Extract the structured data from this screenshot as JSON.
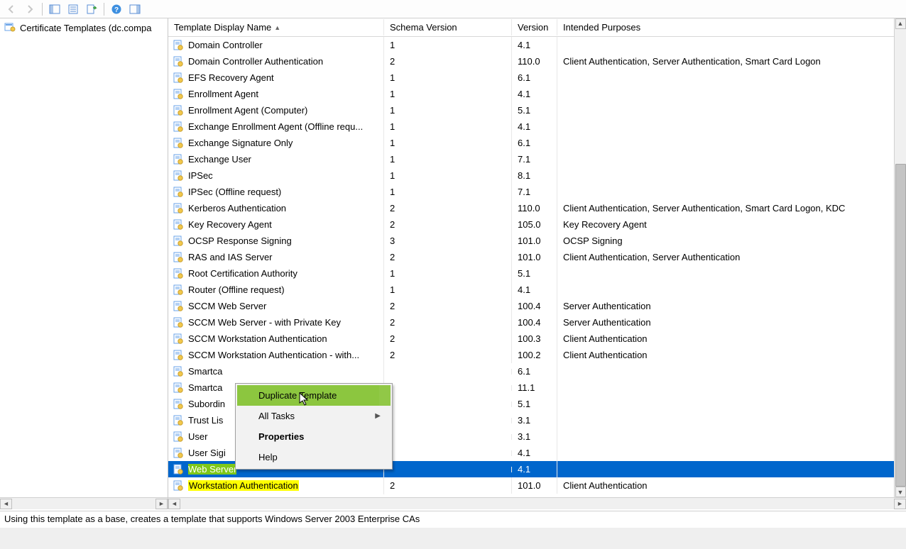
{
  "tree": {
    "root_label": "Certificate Templates (dc.compa"
  },
  "columns": {
    "name": "Template Display Name",
    "schema": "Schema Version",
    "version": "Version",
    "purposes": "Intended Purposes"
  },
  "rows": [
    {
      "name": "Domain Controller",
      "schema": "1",
      "version": "4.1",
      "purposes": ""
    },
    {
      "name": "Domain Controller Authentication",
      "schema": "2",
      "version": "110.0",
      "purposes": "Client Authentication, Server Authentication, Smart Card Logon"
    },
    {
      "name": "EFS Recovery Agent",
      "schema": "1",
      "version": "6.1",
      "purposes": ""
    },
    {
      "name": "Enrollment Agent",
      "schema": "1",
      "version": "4.1",
      "purposes": ""
    },
    {
      "name": "Enrollment Agent (Computer)",
      "schema": "1",
      "version": "5.1",
      "purposes": ""
    },
    {
      "name": "Exchange Enrollment Agent (Offline requ...",
      "schema": "1",
      "version": "4.1",
      "purposes": ""
    },
    {
      "name": "Exchange Signature Only",
      "schema": "1",
      "version": "6.1",
      "purposes": ""
    },
    {
      "name": "Exchange User",
      "schema": "1",
      "version": "7.1",
      "purposes": ""
    },
    {
      "name": "IPSec",
      "schema": "1",
      "version": "8.1",
      "purposes": ""
    },
    {
      "name": "IPSec (Offline request)",
      "schema": "1",
      "version": "7.1",
      "purposes": ""
    },
    {
      "name": "Kerberos Authentication",
      "schema": "2",
      "version": "110.0",
      "purposes": "Client Authentication, Server Authentication, Smart Card Logon, KDC"
    },
    {
      "name": "Key Recovery Agent",
      "schema": "2",
      "version": "105.0",
      "purposes": "Key Recovery Agent"
    },
    {
      "name": "OCSP Response Signing",
      "schema": "3",
      "version": "101.0",
      "purposes": "OCSP Signing"
    },
    {
      "name": "RAS and IAS Server",
      "schema": "2",
      "version": "101.0",
      "purposes": "Client Authentication, Server Authentication"
    },
    {
      "name": "Root Certification Authority",
      "schema": "1",
      "version": "5.1",
      "purposes": ""
    },
    {
      "name": "Router (Offline request)",
      "schema": "1",
      "version": "4.1",
      "purposes": ""
    },
    {
      "name": "SCCM Web Server",
      "schema": "2",
      "version": "100.4",
      "purposes": "Server Authentication"
    },
    {
      "name": "SCCM Web Server - with Private Key",
      "schema": "2",
      "version": "100.4",
      "purposes": "Server Authentication"
    },
    {
      "name": "SCCM Workstation Authentication",
      "schema": "2",
      "version": "100.3",
      "purposes": "Client Authentication"
    },
    {
      "name": "SCCM Workstation Authentication - with...",
      "schema": "2",
      "version": "100.2",
      "purposes": "Client Authentication"
    },
    {
      "name": "Smartca",
      "schema": "",
      "version": "6.1",
      "purposes": ""
    },
    {
      "name": "Smartca",
      "schema": "",
      "version": "11.1",
      "purposes": ""
    },
    {
      "name": "Subordin",
      "schema": "",
      "version": "5.1",
      "purposes": ""
    },
    {
      "name": "Trust Lis",
      "schema": "",
      "version": "3.1",
      "purposes": ""
    },
    {
      "name": "User",
      "schema": "",
      "version": "3.1",
      "purposes": ""
    },
    {
      "name": "User Sigi",
      "schema": "",
      "version": "4.1",
      "purposes": ""
    },
    {
      "name": "Web Server",
      "schema": "",
      "version": "4.1",
      "purposes": "",
      "selected": true,
      "hl_green": true
    },
    {
      "name": "Workstation Authentication",
      "schema": "2",
      "version": "101.0",
      "purposes": "Client Authentication",
      "hl_yellow": true
    }
  ],
  "context_menu": {
    "duplicate": "Duplicate Template",
    "all_tasks": "All Tasks",
    "properties": "Properties",
    "help": "Help"
  },
  "status": "Using this template as a base, creates a template that supports Windows Server 2003 Enterprise CAs"
}
